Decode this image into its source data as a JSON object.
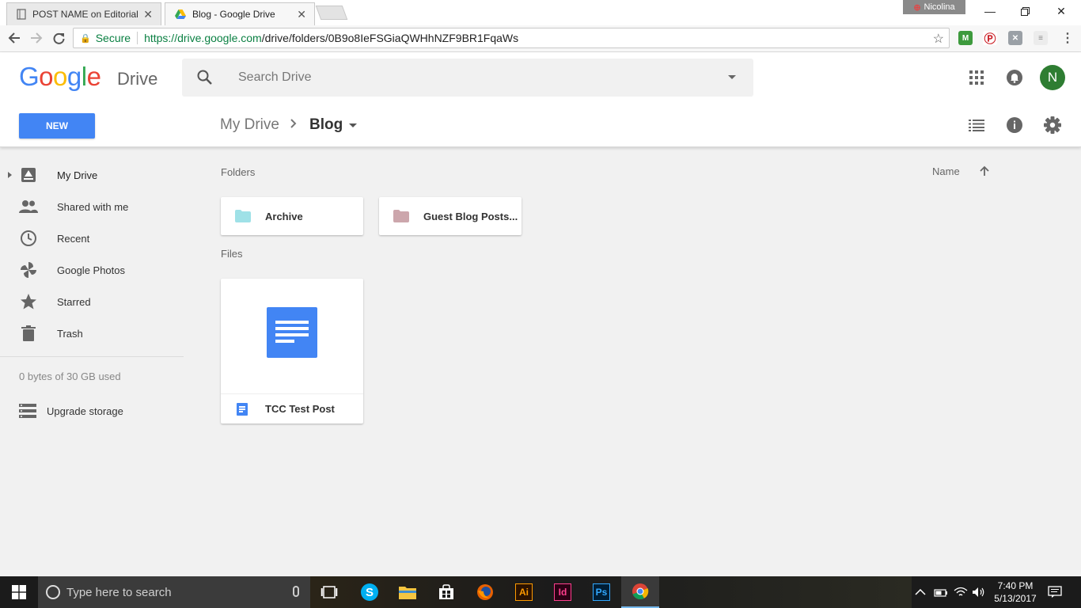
{
  "browser": {
    "tabs": [
      {
        "title": "POST NAME on Editorial",
        "active": false
      },
      {
        "title": "Blog - Google Drive",
        "active": true
      }
    ],
    "profile_name": "Nicolina",
    "secure_label": "Secure",
    "url_host": "https://drive.google.com",
    "url_path": "/drive/folders/0B9o8IeFSGiaQWHhNZF9BR1FqaWs"
  },
  "drive": {
    "logo_text": "Google",
    "product": "Drive",
    "search_placeholder": "Search Drive",
    "avatar_initial": "N",
    "new_button": "NEW",
    "breadcrumb": {
      "root": "My Drive",
      "current": "Blog"
    },
    "sidebar": {
      "items": [
        {
          "label": "My Drive",
          "icon": "drive-icon"
        },
        {
          "label": "Shared with me",
          "icon": "people-icon"
        },
        {
          "label": "Recent",
          "icon": "clock-icon"
        },
        {
          "label": "Google Photos",
          "icon": "pinwheel-icon"
        },
        {
          "label": "Starred",
          "icon": "star-icon"
        },
        {
          "label": "Trash",
          "icon": "trash-icon"
        }
      ],
      "storage": "0 bytes of 30 GB used",
      "upgrade": "Upgrade storage"
    },
    "main": {
      "folders_label": "Folders",
      "files_label": "Files",
      "sort_label": "Name",
      "folders": [
        {
          "name": "Archive",
          "color": "#9fe1e7"
        },
        {
          "name": "Guest Blog Posts...",
          "color": "#cca6ac"
        }
      ],
      "files": [
        {
          "name": "TCC Test Post",
          "type": "google-doc"
        }
      ]
    }
  },
  "taskbar": {
    "search_placeholder": "Type here to search",
    "apps": [
      "task-view",
      "skype",
      "file-explorer",
      "store",
      "firefox",
      "illustrator",
      "indesign",
      "photoshop",
      "chrome"
    ],
    "app_labels": {
      "illustrator": "Ai",
      "indesign": "Id",
      "photoshop": "Ps"
    },
    "time": "7:40 PM",
    "date": "5/13/2017"
  },
  "colors": {
    "accent": "#4285f4",
    "avatar_bg": "#2e7d32",
    "secure_green": "#0b8043"
  }
}
